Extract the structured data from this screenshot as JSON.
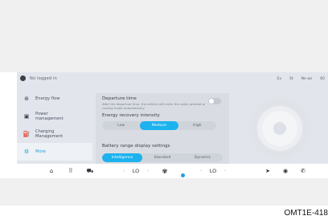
{
  "status_bar": {
    "account_name": "No logged in",
    "indicators": [
      "Ex",
      "St",
      "Ne ws",
      "60"
    ]
  },
  "sidebar": {
    "items": [
      {
        "label": "Energy flow",
        "icon": "energy-flow-icon",
        "active": false
      },
      {
        "label": "Power\nmanagement",
        "icon": "power-management-icon",
        "active": false
      },
      {
        "label": "Charging\nManagement",
        "icon": "charging-icon",
        "active": false
      },
      {
        "label": "More",
        "icon": "more-settings-icon",
        "active": true
      }
    ]
  },
  "settings": {
    "departure_time": {
      "title": "Departure time",
      "description": "After the departure time, the vehicle will enter the cabin preheat or cooling mode automatically",
      "enabled": false
    },
    "energy_recovery": {
      "title": "Energy recovery intensity",
      "options": [
        "Low",
        "Medium",
        "High"
      ],
      "selected": "Medium"
    },
    "battery_range": {
      "title": "Battery range display settings",
      "options": [
        "Intelligence",
        "Standard",
        "Dynamic"
      ],
      "selected": "Intelligence"
    }
  },
  "dock": {
    "left_temp": "LO",
    "right_temp": "LO",
    "left_arrow_down": "‹",
    "left_arrow_up": "›",
    "right_arrow_down": "‹",
    "right_arrow_up": "›"
  },
  "caption": "OMT1E-418",
  "colors": {
    "accent": "#1cb2ee",
    "background": "#e2e6ec"
  }
}
